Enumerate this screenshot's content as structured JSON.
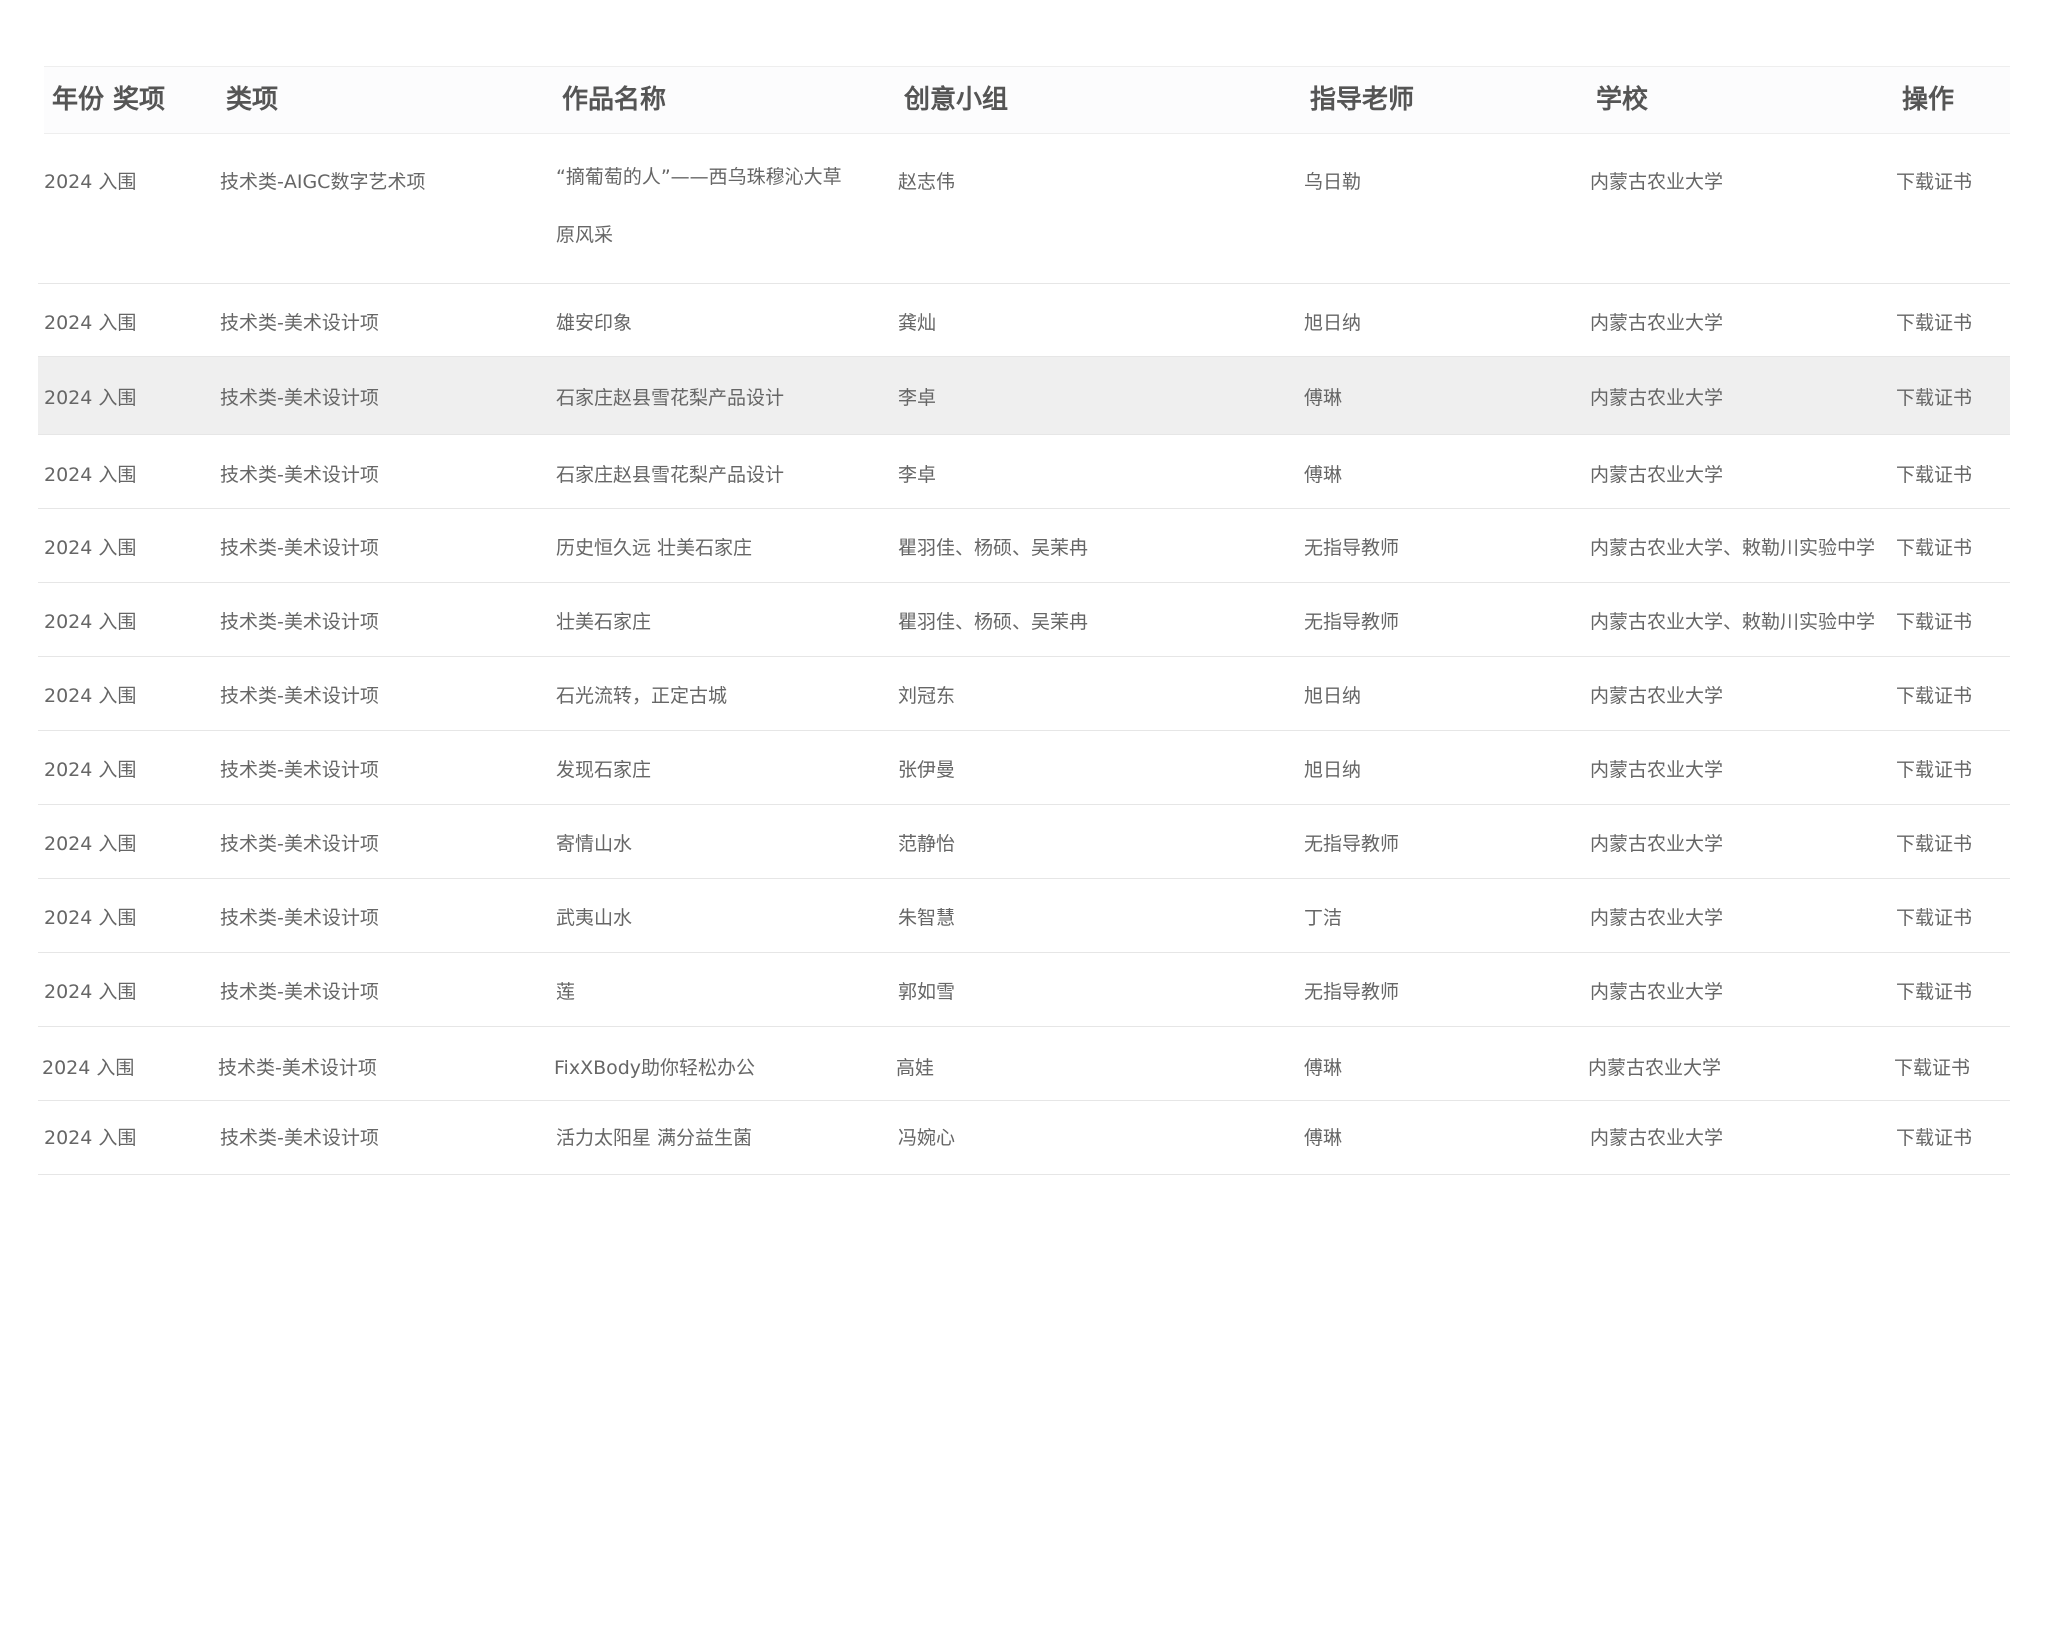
{
  "table": {
    "headers": {
      "year_award": "年份 奖项",
      "category": "类项",
      "work_title": "作品名称",
      "team": "创意小组",
      "teacher": "指导老师",
      "school": "学校",
      "action": "操作"
    },
    "rows": [
      {
        "year_award": "2024  入围",
        "category": "技术类-AIGC数字艺术项",
        "work_title": "“摘葡萄的人”——西乌珠穆沁大草原风采",
        "team": "赵志伟",
        "teacher": "乌日勒",
        "school": "内蒙古农业大学",
        "action": "下载证书"
      },
      {
        "year_award": "2024  入围",
        "category": "技术类-美术设计项",
        "work_title": "雄安印象",
        "team": "龚灿",
        "teacher": "旭日纳",
        "school": "内蒙古农业大学",
        "action": "下载证书"
      },
      {
        "year_award": "2024  入围",
        "category": "技术类-美术设计项",
        "work_title": "石家庄赵县雪花梨产品设计",
        "team": "李卓",
        "teacher": "傅琳",
        "school": "内蒙古农业大学",
        "action": "下载证书"
      },
      {
        "year_award": "2024  入围",
        "category": "技术类-美术设计项",
        "work_title": "石家庄赵县雪花梨产品设计",
        "team": "李卓",
        "teacher": "傅琳",
        "school": "内蒙古农业大学",
        "action": "下载证书"
      },
      {
        "year_award": "2024  入围",
        "category": "技术类-美术设计项",
        "work_title": "历史恒久远 壮美石家庄",
        "team": "瞿羽佳、杨硕、吴茉冉",
        "teacher": "无指导教师",
        "school": "内蒙古农业大学、敕勒川实验中学",
        "action": "下载证书"
      },
      {
        "year_award": "2024  入围",
        "category": "技术类-美术设计项",
        "work_title": "壮美石家庄",
        "team": "瞿羽佳、杨硕、吴茉冉",
        "teacher": "无指导教师",
        "school": "内蒙古农业大学、敕勒川实验中学",
        "action": "下载证书"
      },
      {
        "year_award": "2024  入围",
        "category": "技术类-美术设计项",
        "work_title": "石光流转，正定古城",
        "team": "刘冠东",
        "teacher": "旭日纳",
        "school": "内蒙古农业大学",
        "action": "下载证书"
      },
      {
        "year_award": "2024  入围",
        "category": "技术类-美术设计项",
        "work_title": "发现石家庄",
        "team": "张伊曼",
        "teacher": "旭日纳",
        "school": "内蒙古农业大学",
        "action": "下载证书"
      },
      {
        "year_award": "2024  入围",
        "category": "技术类-美术设计项",
        "work_title": "寄情山水",
        "team": "范静怡",
        "teacher": "无指导教师",
        "school": "内蒙古农业大学",
        "action": "下载证书"
      },
      {
        "year_award": "2024  入围",
        "category": "技术类-美术设计项",
        "work_title": "武夷山水",
        "team": "朱智慧",
        "teacher": "丁洁",
        "school": "内蒙古农业大学",
        "action": "下载证书"
      },
      {
        "year_award": "2024  入围",
        "category": "技术类-美术设计项",
        "work_title": "莲",
        "team": "郭如雪",
        "teacher": "无指导教师",
        "school": "内蒙古农业大学",
        "action": "下载证书"
      },
      {
        "year_award": "2024  入围",
        "category": "技术类-美术设计项",
        "work_title": "FixXBody助你轻松办公",
        "team": "高娃",
        "teacher": "傅琳",
        "school": "内蒙古农业大学",
        "action": "下载证书"
      },
      {
        "year_award": "2024  入围",
        "category": "技术类-美术设计项",
        "work_title": "活力太阳星 满分益生菌",
        "team": "冯婉心",
        "teacher": "傅琳",
        "school": "内蒙古农业大学",
        "action": "下载证书"
      }
    ]
  }
}
